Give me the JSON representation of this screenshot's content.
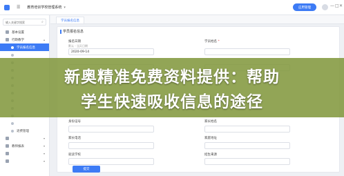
{
  "topbar": {
    "system_title": "教育培训学校管理系统",
    "primary_button": "应用管理",
    "window_controls": [
      "—",
      "□",
      "✕"
    ]
  },
  "sidebar": {
    "search_placeholder": "输入关键字搜索",
    "items": [
      {
        "label": "基本设置",
        "level": 1,
        "icon": "settings-icon"
      },
      {
        "label": "行政教学",
        "level": 1,
        "icon": "teaching-icon"
      },
      {
        "label": "学员报名信息",
        "level": 2,
        "active": true
      },
      {
        "label": "",
        "level": 2
      },
      {
        "label": "",
        "level": 2
      },
      {
        "label": "",
        "level": 2
      },
      {
        "label": "",
        "level": 2
      },
      {
        "label": "",
        "level": 2
      },
      {
        "label": "",
        "level": 2
      },
      {
        "label": "",
        "level": 2
      },
      {
        "label": "",
        "level": 2
      },
      {
        "label": "",
        "level": 2
      },
      {
        "label": "",
        "level": 2
      },
      {
        "label": "退费管理",
        "level": 2
      },
      {
        "label": "",
        "level": 1
      },
      {
        "label": "教师报表",
        "level": 1,
        "icon": "report-icon"
      },
      {
        "label": "",
        "level": 1
      },
      {
        "label": "",
        "level": 1
      }
    ]
  },
  "tabs": [
    "学员报名信息"
  ],
  "form": {
    "section_title": "学员报名信息",
    "fields": {
      "signup_date": {
        "label": "报名日期",
        "hint": "默认 - 当天日期",
        "value": "2020-09-14"
      },
      "student_name": {
        "label": "学员姓名",
        "required": "*",
        "value": ""
      },
      "row2_left": {
        "label": "",
        "value": ""
      },
      "row2_right": {
        "label": "",
        "value": ""
      },
      "id_card": {
        "label": "身份证号",
        "value": ""
      },
      "parent_name": {
        "label": "家长姓名",
        "value": ""
      },
      "parent_phone": {
        "label": "家长电话",
        "value": ""
      },
      "home_address": {
        "label": "家庭地址",
        "value": ""
      },
      "school": {
        "label": "就读学校",
        "value": ""
      },
      "enroll_source": {
        "label": "招生来源",
        "value": ""
      }
    },
    "submit_label": "提交"
  },
  "banner": {
    "line1": "新奥精准免费资料提供：帮助",
    "line2": "学生快速吸收信息的途径"
  },
  "colors": {
    "accent": "#3d7bf5",
    "banner": "#80963a",
    "required": "#e5484d"
  }
}
